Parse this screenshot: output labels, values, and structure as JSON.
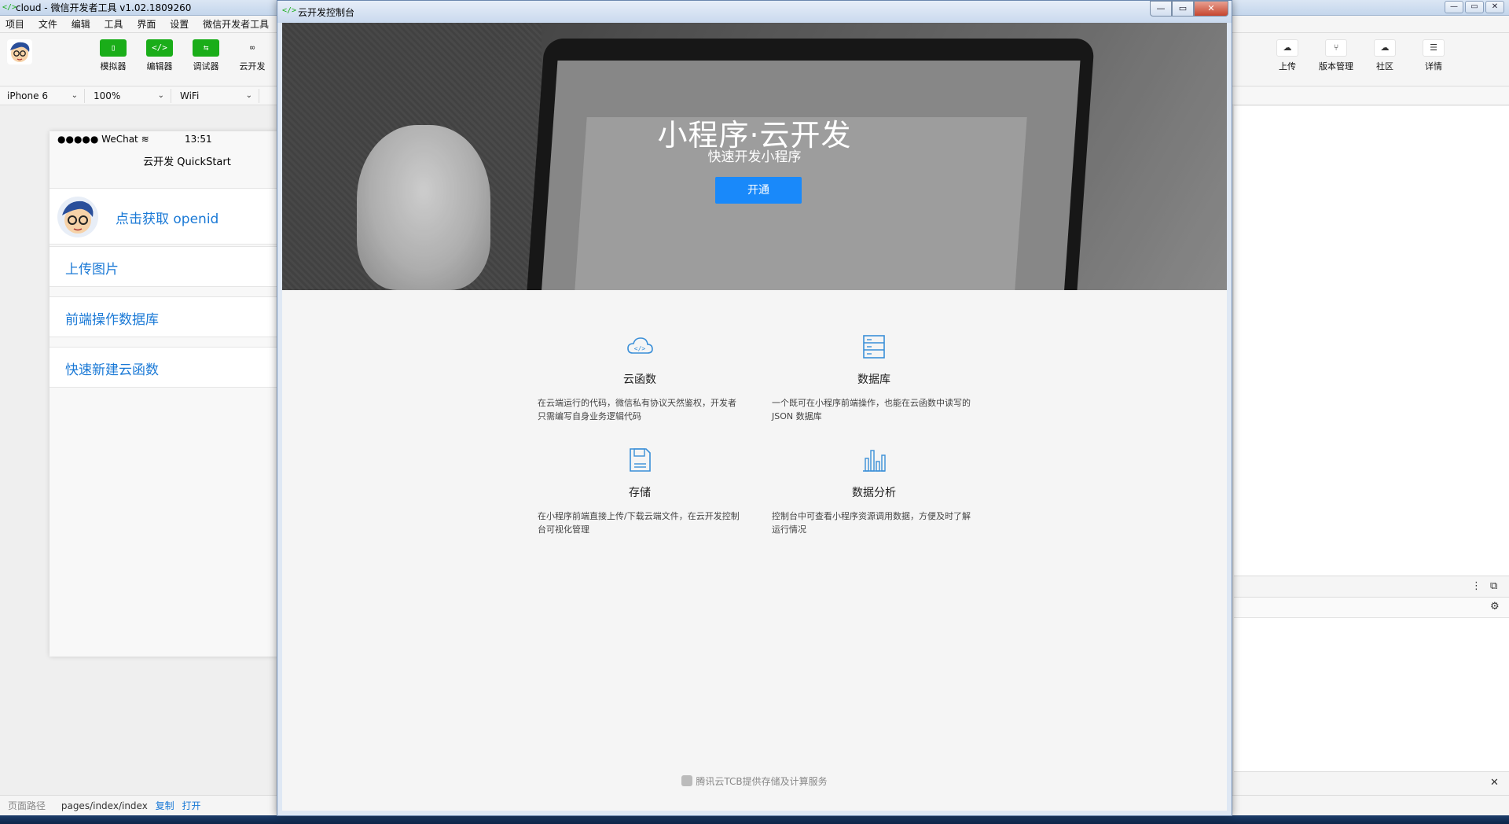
{
  "ide": {
    "title": "cloud - 微信开发者工具 v1.02.1809260",
    "menu": [
      "项目",
      "文件",
      "编辑",
      "工具",
      "界面",
      "设置",
      "微信开发者工具"
    ],
    "toolbar_left": [
      {
        "label": "模拟器",
        "icon": "phone-icon",
        "glyph": "▯"
      },
      {
        "label": "编辑器",
        "icon": "code-icon",
        "glyph": "</>"
      },
      {
        "label": "调试器",
        "icon": "debug-icon",
        "glyph": "⇆"
      },
      {
        "label": "云开发",
        "icon": "cloud-link-icon",
        "glyph": "∞"
      }
    ],
    "toolbar_right": [
      {
        "label": "上传",
        "icon": "upload-icon",
        "glyph": "☁"
      },
      {
        "label": "版本管理",
        "icon": "version-icon",
        "glyph": "⑂"
      },
      {
        "label": "社区",
        "icon": "community-icon",
        "glyph": "☁"
      },
      {
        "label": "详情",
        "icon": "details-icon",
        "glyph": "☰"
      }
    ],
    "device": "iPhone 6",
    "zoom": "100%",
    "network": "WiFi",
    "path_label": "页面路径",
    "path_value": "pages/index/index",
    "path_copy": "复制",
    "path_open": "打开"
  },
  "simulator": {
    "carrier": "●●●●● WeChat",
    "time": "13:51",
    "nav_title": "云开发 QuickStart",
    "items": [
      "点击获取 openid",
      "上传图片",
      "前端操作数据库",
      "快速新建云函数"
    ]
  },
  "console": {
    "title": "云开发控制台",
    "hero_title": "小程序·云开发",
    "hero_subtitle": "快速开发小程序",
    "open_button": "开通",
    "features": [
      {
        "name": "云函数",
        "desc": "在云端运行的代码，微信私有协议天然鉴权，开发者只需编写自身业务逻辑代码",
        "icon": "cloud-function-icon"
      },
      {
        "name": "数据库",
        "desc": "一个既可在小程序前端操作，也能在云函数中读写的 JSON 数据库",
        "icon": "database-icon"
      },
      {
        "name": "存储",
        "desc": "在小程序前端直接上传/下载云端文件，在云开发控制台可视化管理",
        "icon": "storage-icon"
      },
      {
        "name": "数据分析",
        "desc": "控制台中可查看小程序资源调用数据，方便及时了解运行情况",
        "icon": "analytics-icon"
      }
    ],
    "footer": "腾讯云TCB提供存储及计算服务"
  },
  "colors": {
    "accent": "#1aad19",
    "primary_button": "#1989fa",
    "link_blue": "#1a79d6",
    "icon_blue": "#3a8fd8"
  }
}
